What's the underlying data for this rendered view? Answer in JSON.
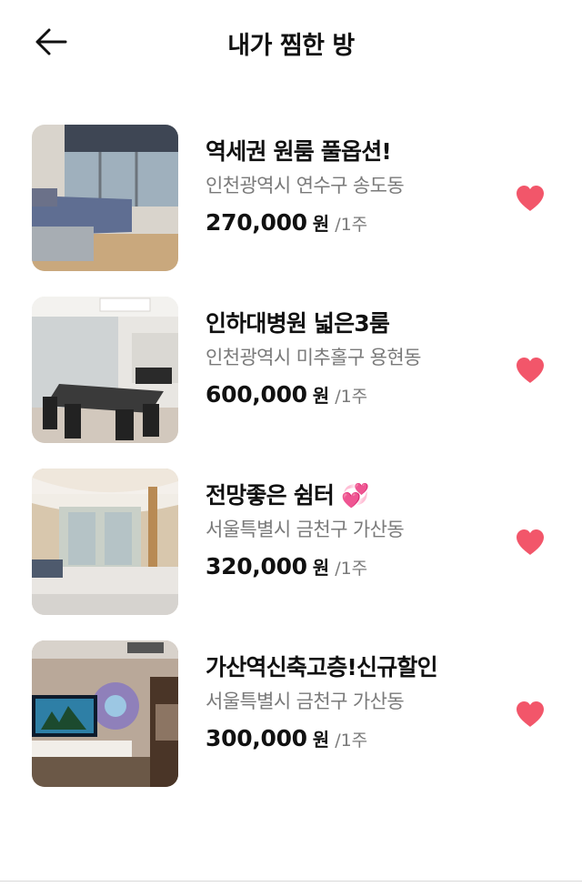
{
  "header": {
    "title": "내가 찜한 방",
    "back_icon": "arrow-left-icon"
  },
  "colors": {
    "heart": "#f2566a",
    "text": "#111111",
    "subtext": "#7a7a7a"
  },
  "rooms": [
    {
      "name": "역세권 원룸 풀옵션!",
      "address": "인천광역시 연수구 송도동",
      "price": "270,000",
      "currency": "원",
      "period": "/1주",
      "liked": true
    },
    {
      "name": "인하대병원 넓은3룸",
      "address": "인천광역시 미추홀구 용현동",
      "price": "600,000",
      "currency": "원",
      "period": "/1주",
      "liked": true
    },
    {
      "name": "전망좋은 쉼터 💞",
      "address": "서울특별시 금천구 가산동",
      "price": "320,000",
      "currency": "원",
      "period": "/1주",
      "liked": true
    },
    {
      "name": "가산역신축고층!신규할인",
      "address": "서울특별시 금천구 가산동",
      "price": "300,000",
      "currency": "원",
      "period": "/1주",
      "liked": true
    }
  ]
}
